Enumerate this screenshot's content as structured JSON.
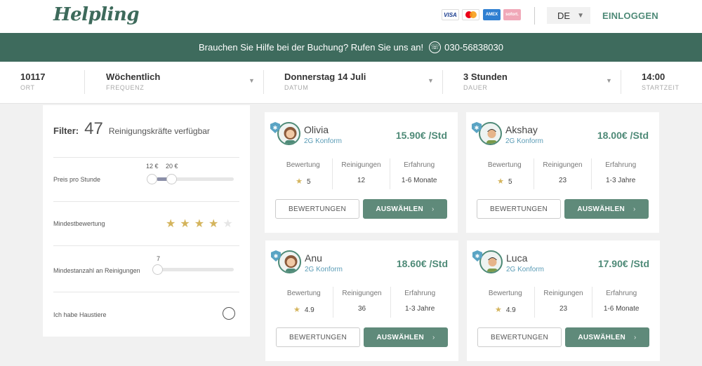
{
  "header": {
    "logo": "Helpling",
    "payments": [
      "visa-icon",
      "mastercard-icon",
      "amex-icon",
      "sofort-icon"
    ],
    "payment_labels": {
      "visa": "VISA",
      "amex": "AMEX",
      "sofort": "sofort."
    },
    "language": "DE",
    "login": "EINLOGGEN"
  },
  "banner": {
    "text": "Brauchen Sie Hilfe bei der Buchung? Rufen Sie uns an!",
    "phone": "030-56838030"
  },
  "search": {
    "ort": {
      "value": "10117",
      "label": "ORT"
    },
    "frequenz": {
      "value": "Wöchentlich",
      "label": "FREQUENZ"
    },
    "datum": {
      "value": "Donnerstag 14 Juli",
      "label": "DATUM"
    },
    "dauer": {
      "value": "3 Stunden",
      "label": "DAUER"
    },
    "startzeit": {
      "value": "14:00",
      "label": "STARTZEIT"
    }
  },
  "filter": {
    "title": "Filter:",
    "count": "47",
    "count_label": "Reinigungskräfte verfügbar",
    "price_label": "Preis pro Stunde",
    "price_min": "12 €",
    "price_max": "20 €",
    "rating_label": "Mindestbewertung",
    "rating_value": 4,
    "rating_max": 5,
    "cleanings_label": "Mindestanzahl an Reinigungen",
    "cleanings_value": "7",
    "pets_label": "Ich habe Haustiere"
  },
  "colors": {
    "accent": "#4e8a77",
    "banner": "#3e6b5d",
    "button": "#5f8a7a",
    "star": "#d4b45c",
    "badge": "#5aa4c4"
  },
  "cleaners": [
    {
      "name": "Olivia",
      "conformity": "2G Konform",
      "price": "15.90€ /Std",
      "rating": "5",
      "cleanings": "12",
      "experience": "1-6 Monate",
      "avatar": "female"
    },
    {
      "name": "Akshay",
      "conformity": "2G Konform",
      "price": "18.00€ /Std",
      "rating": "5",
      "cleanings": "23",
      "experience": "1-3 Jahre",
      "avatar": "male"
    },
    {
      "name": "Anu",
      "conformity": "2G Konform",
      "price": "18.60€ /Std",
      "rating": "4.9",
      "cleanings": "36",
      "experience": "1-3 Jahre",
      "avatar": "female"
    },
    {
      "name": "Luca",
      "conformity": "2G Konform",
      "price": "17.90€ /Std",
      "rating": "4.9",
      "cleanings": "23",
      "experience": "1-6 Monate",
      "avatar": "male"
    }
  ],
  "card_labels": {
    "rating": "Bewertung",
    "cleanings": "Reinigungen",
    "experience": "Erfahrung",
    "reviews_button": "BEWERTUNGEN",
    "select_button": "AUSWÄHLEN"
  }
}
